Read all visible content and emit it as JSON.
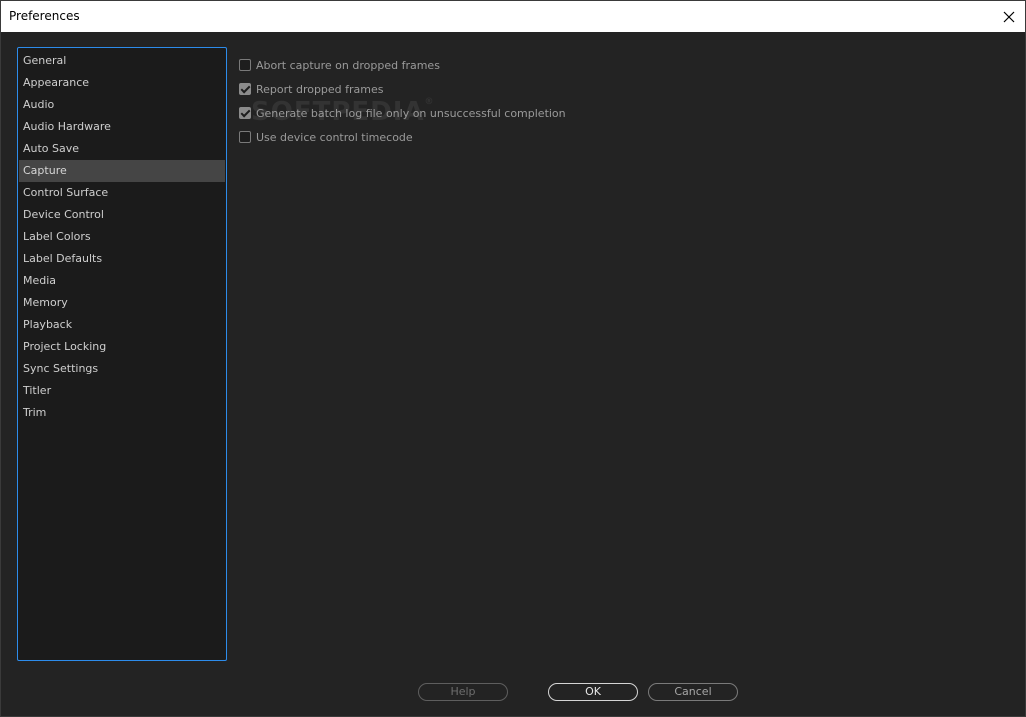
{
  "window": {
    "title": "Preferences"
  },
  "nav": {
    "items": [
      {
        "label": "General"
      },
      {
        "label": "Appearance"
      },
      {
        "label": "Audio"
      },
      {
        "label": "Audio Hardware"
      },
      {
        "label": "Auto Save"
      },
      {
        "label": "Capture",
        "selected": true
      },
      {
        "label": "Control Surface"
      },
      {
        "label": "Device Control"
      },
      {
        "label": "Label Colors"
      },
      {
        "label": "Label Defaults"
      },
      {
        "label": "Media"
      },
      {
        "label": "Memory"
      },
      {
        "label": "Playback"
      },
      {
        "label": "Project Locking"
      },
      {
        "label": "Sync Settings"
      },
      {
        "label": "Titler"
      },
      {
        "label": "Trim"
      }
    ]
  },
  "capture": {
    "options": [
      {
        "label": "Abort capture on dropped frames",
        "checked": false
      },
      {
        "label": "Report dropped frames",
        "checked": true
      },
      {
        "label": "Generate batch log file only on unsuccessful completion",
        "checked": true
      },
      {
        "label": "Use device control timecode",
        "checked": false
      }
    ]
  },
  "watermark": {
    "text": "SOFTPEDIA",
    "mark": "®"
  },
  "buttons": {
    "help": "Help",
    "ok": "OK",
    "cancel": "Cancel"
  },
  "colors": {
    "accent": "#2d8ceb",
    "background": "#232323",
    "selected_row": "#454545"
  },
  "icons": {
    "close": "close-icon"
  }
}
